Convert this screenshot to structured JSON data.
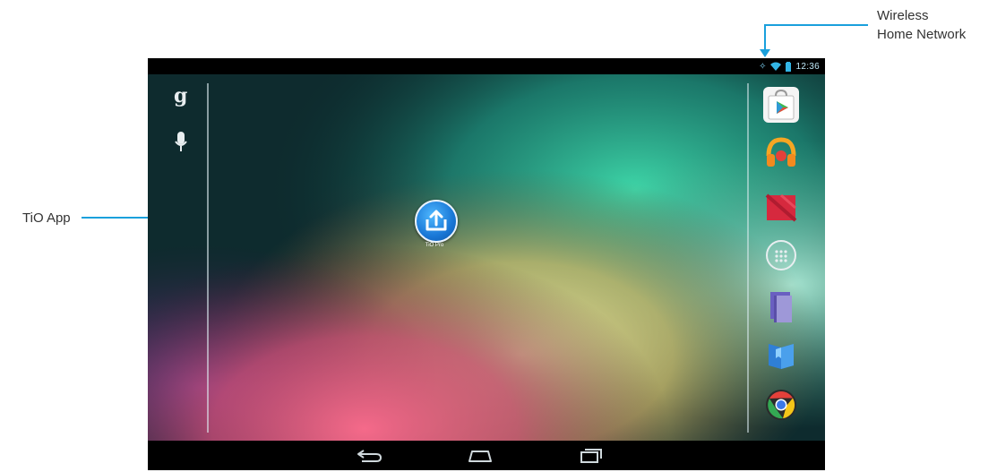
{
  "callouts": {
    "network_line1": "Wireless",
    "network_line2": "Home Network",
    "app": "TiO App"
  },
  "status_bar": {
    "time": "12:36"
  },
  "home_screen": {
    "search_glyph": "g",
    "app_shortcut_label": "TiO Pro"
  },
  "dock": {
    "icons": [
      "play-store-icon",
      "play-music-icon",
      "play-books-icon",
      "all-apps-icon",
      "book-reader-icon",
      "play-books-blue-icon",
      "chrome-icon"
    ]
  },
  "navigation": {
    "buttons": [
      "back-icon",
      "home-icon",
      "recent-apps-icon"
    ]
  },
  "colors": {
    "accent": "#1aa0dc",
    "bar": "#000000"
  }
}
